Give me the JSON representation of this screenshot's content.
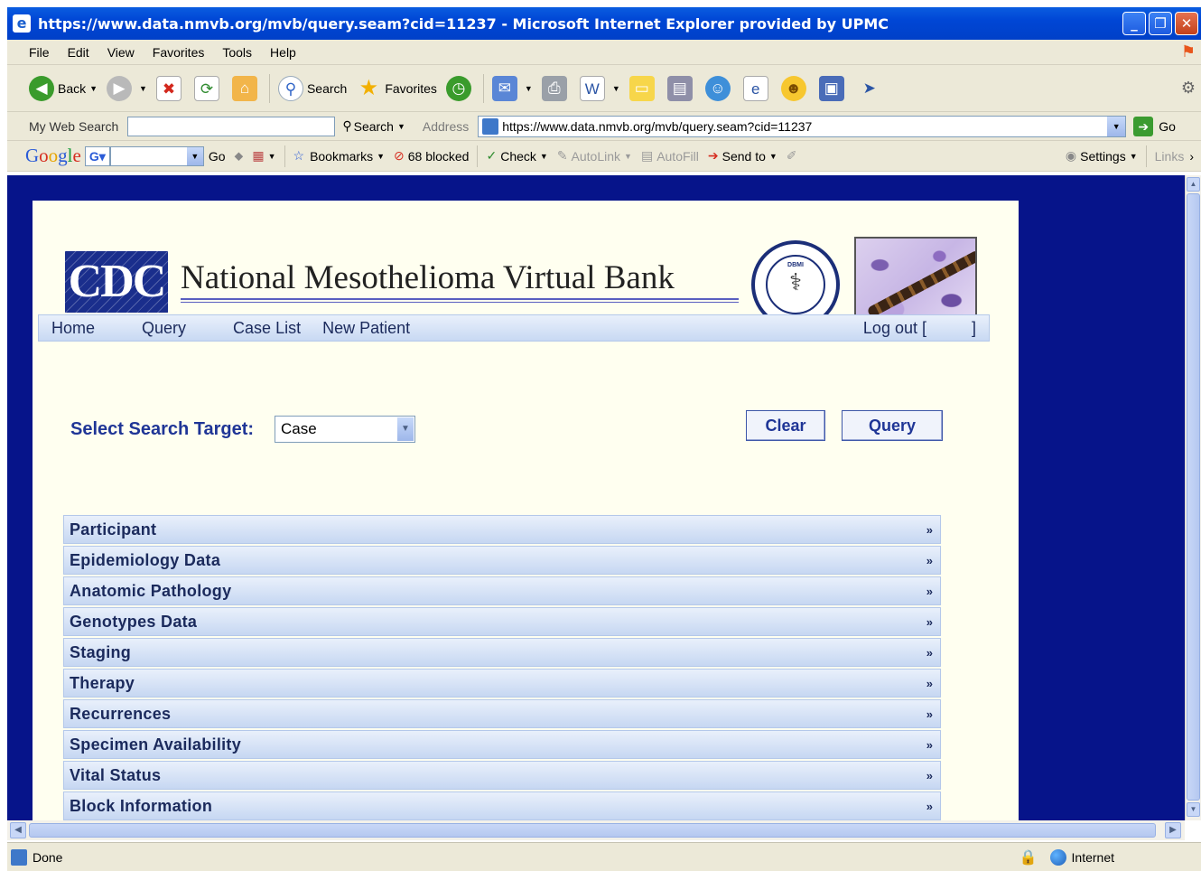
{
  "window": {
    "title": "https://www.data.nmvb.org/mvb/query.seam?cid=11237 - Microsoft Internet Explorer provided by UPMC"
  },
  "menu": [
    "File",
    "Edit",
    "View",
    "Favorites",
    "Tools",
    "Help"
  ],
  "toolbar": {
    "back": "Back",
    "search": "Search",
    "favorites": "Favorites"
  },
  "address_bar": {
    "my_web_search_label": "My Web Search",
    "search_button": "Search",
    "address_label": "Address",
    "url": "https://www.data.nmvb.org/mvb/query.seam?cid=11237",
    "go": "Go"
  },
  "google_bar": {
    "go": "Go",
    "bookmarks": "Bookmarks",
    "blocked": "68 blocked",
    "check": "Check",
    "autolink": "AutoLink",
    "autofill": "AutoFill",
    "send_to": "Send to",
    "settings": "Settings",
    "links": "Links"
  },
  "site": {
    "logo_text": "CDC",
    "title": "National Mesothelioma Virtual Bank",
    "seal_abbr": "DBMI"
  },
  "nav": {
    "items": [
      "Home",
      "Query",
      "Case List",
      "New Patient"
    ],
    "logout": "Log out [          ]"
  },
  "search": {
    "label": "Select Search Target:",
    "selected": "Case",
    "clear": "Clear",
    "query": "Query"
  },
  "sections": [
    "Participant",
    "Epidemiology Data",
    "Anatomic Pathology",
    "Genotypes Data",
    "Staging",
    "Therapy",
    "Recurrences",
    "Specimen Availability",
    "Vital Status",
    "Block Information"
  ],
  "status": {
    "text": "Done",
    "zone": "Internet"
  },
  "colors": {
    "page_background": "#06148a",
    "content_background": "#fffff0",
    "accent_text": "#1f3596"
  }
}
